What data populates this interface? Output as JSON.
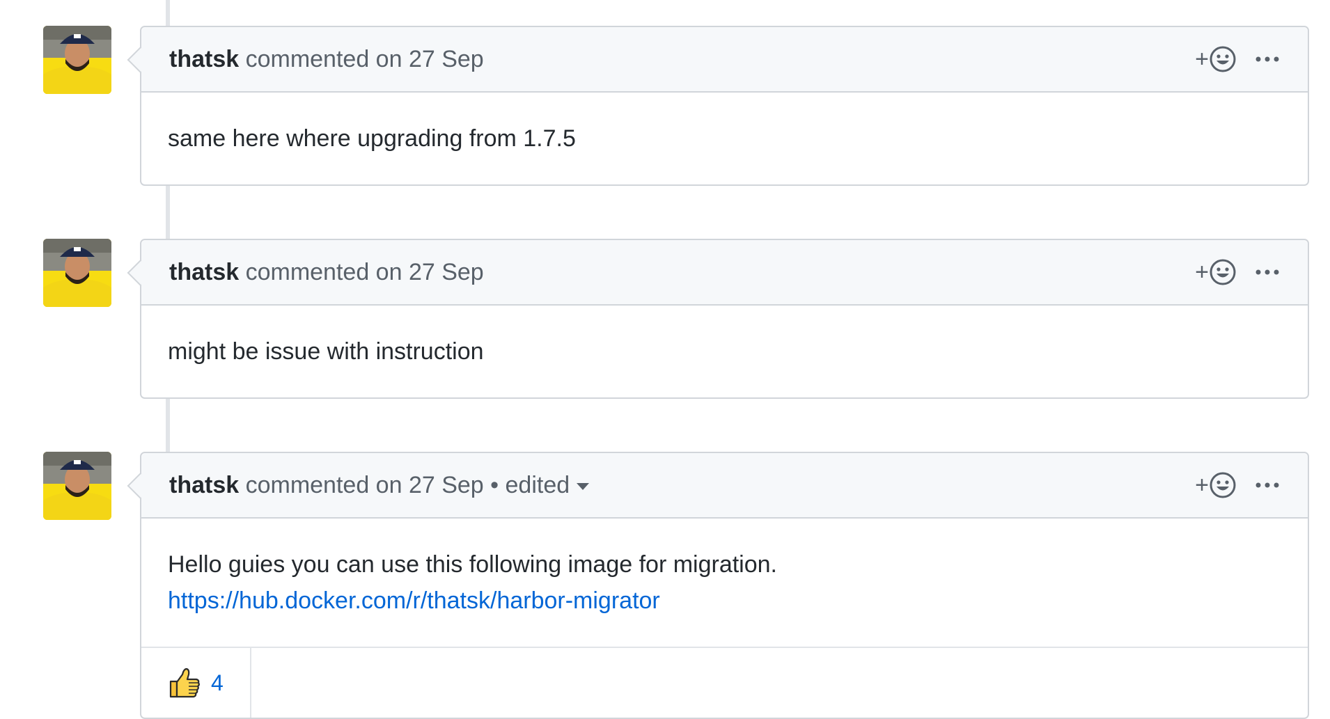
{
  "comments": [
    {
      "author": "thatsk",
      "meta": "commented on 27 Sep",
      "edited": "",
      "body_lines": [
        "same here where upgrading from 1.7.5"
      ],
      "link": "",
      "reactions": []
    },
    {
      "author": "thatsk",
      "meta": "commented on 27 Sep",
      "edited": "",
      "body_lines": [
        "might be issue with instruction"
      ],
      "link": "",
      "reactions": []
    },
    {
      "author": "thatsk",
      "meta": "commented on 27 Sep",
      "edited": "• edited",
      "body_lines": [
        "Hello guies you can use this following image for migration."
      ],
      "link": "https://hub.docker.com/r/thatsk/harbor-migrator",
      "reactions": [
        {
          "icon": "thumbs-up-icon",
          "count": "4"
        }
      ]
    }
  ],
  "header_actions": {
    "add_reaction_label": "+",
    "add_reaction_icon": "smiley-icon",
    "more_icon": "kebab-horizontal-icon"
  },
  "colors": {
    "link": "#0366d6",
    "header_bg": "#f6f8fa",
    "border": "#d1d5da",
    "avatar_bg": "#f5d90a"
  }
}
